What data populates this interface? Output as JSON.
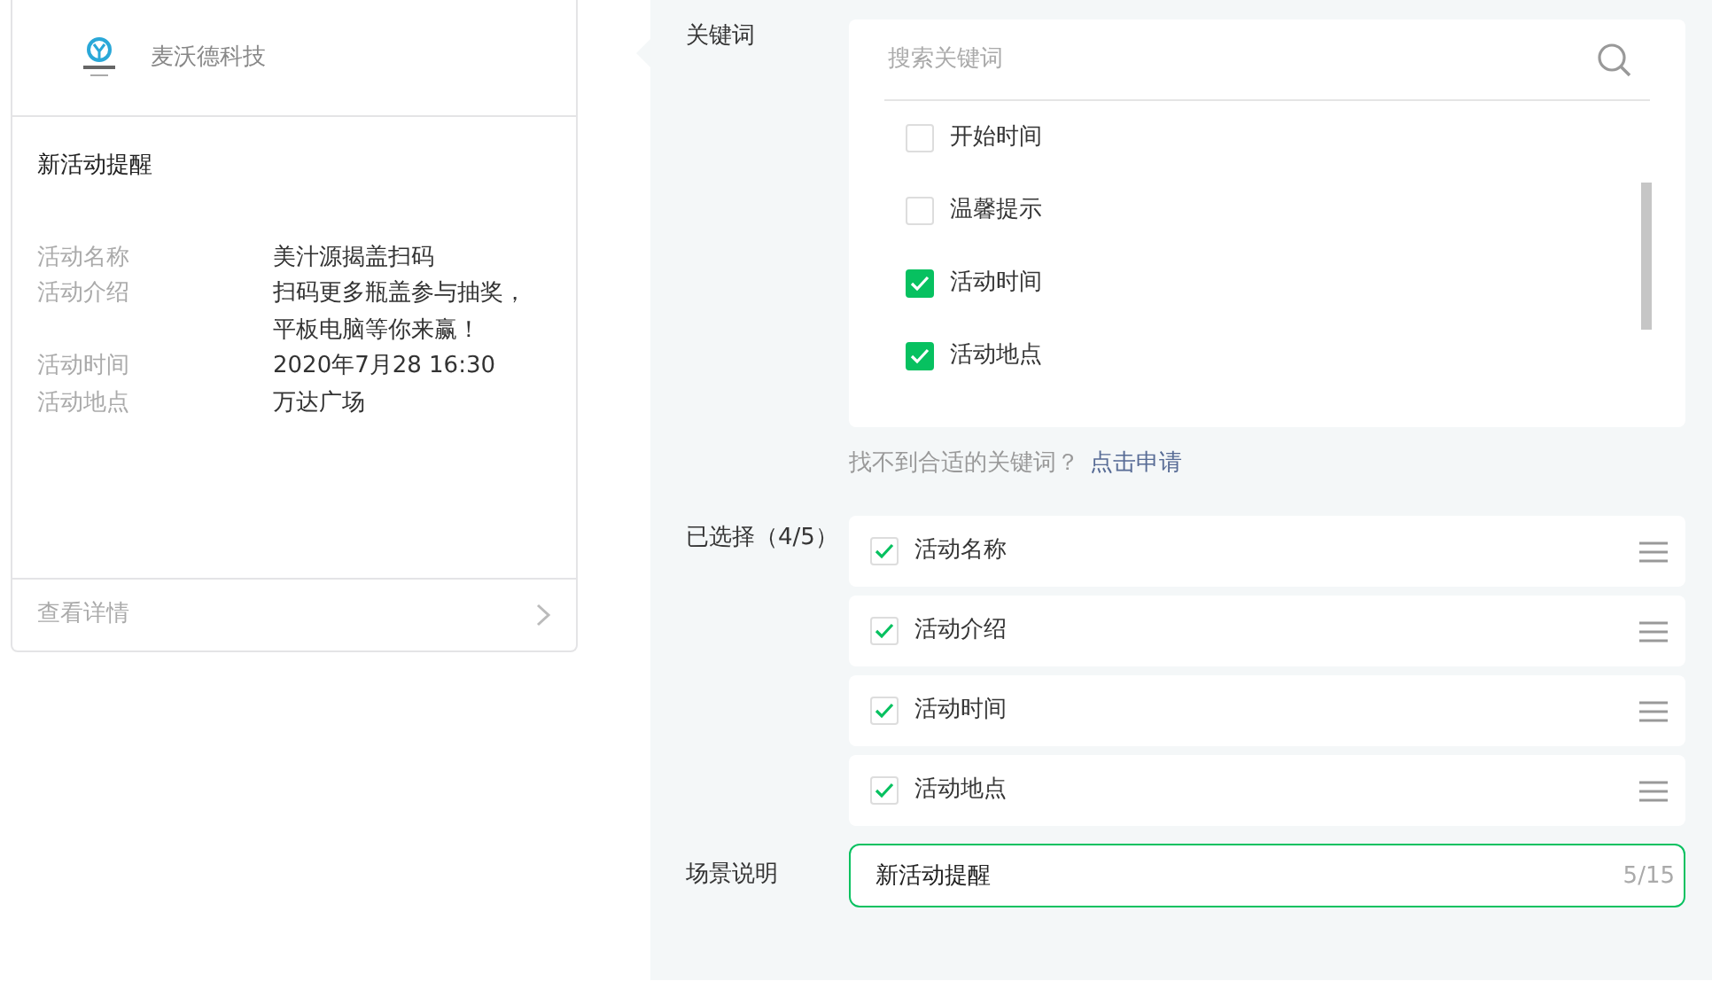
{
  "preview_card": {
    "company": "麦沃德科技",
    "title": "新活动提醒",
    "fields": [
      {
        "label": "活动名称",
        "value": "美汁源揭盖扫码"
      },
      {
        "label": "活动介绍",
        "value": "扫码更多瓶盖参与抽奖，平板电脑等你来赢！"
      },
      {
        "label": "活动时间",
        "value": "2020年7月28 16:30"
      },
      {
        "label": "活动地点",
        "value": "万达广场"
      }
    ],
    "footer_link": "查看详情"
  },
  "form": {
    "keyword_label": "关键词",
    "search": {
      "placeholder": "搜索关键词"
    },
    "keywords": [
      {
        "label": "开始时间",
        "checked": false
      },
      {
        "label": "温馨提示",
        "checked": false
      },
      {
        "label": "活动时间",
        "checked": true
      },
      {
        "label": "活动地点",
        "checked": true
      }
    ],
    "hint": "找不到合适的关键词？",
    "apply_link": "点击申请",
    "selected_label": "已选择（4/5）",
    "selected": [
      {
        "label": "活动名称",
        "checked": true
      },
      {
        "label": "活动介绍",
        "checked": true
      },
      {
        "label": "活动时间",
        "checked": true
      },
      {
        "label": "活动地点",
        "checked": true
      }
    ],
    "description_label": "场景说明",
    "description": {
      "value": "新活动提醒",
      "counter": "5/15"
    }
  }
}
